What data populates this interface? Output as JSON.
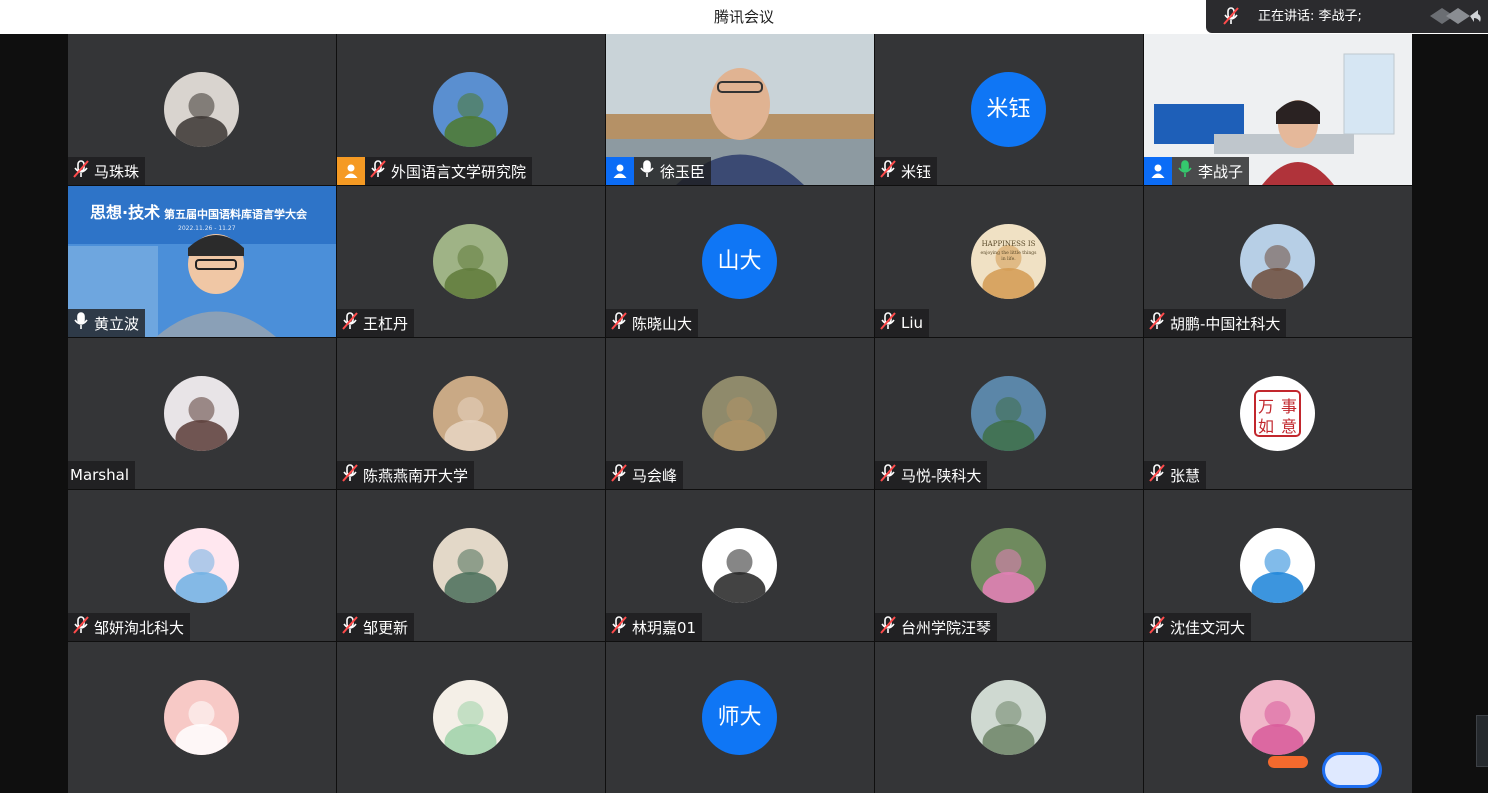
{
  "app": {
    "title": "腾讯会议"
  },
  "speaking": {
    "label": "正在讲话: 李战子;"
  },
  "colors": {
    "accent": "#0f76f5",
    "tile": "#343537",
    "speaking_outline": "#4dc68b",
    "host_badge": "#0b6cf6"
  },
  "participants": [
    {
      "name": "马珠珠",
      "mic": "muted",
      "avatar": "photo"
    },
    {
      "name": "外国语言文学研究院",
      "mic": "muted",
      "avatar": "photo",
      "badge": "orange-user-icon"
    },
    {
      "name": "徐玉臣",
      "mic": "on",
      "avatar": "video",
      "badge": "user-icon"
    },
    {
      "name": "米钰",
      "mic": "muted",
      "avatar": "initials",
      "initials": "米钰"
    },
    {
      "name": "李战子",
      "mic": "speaking",
      "avatar": "video",
      "badge": "user-icon"
    },
    {
      "name": "黄立波",
      "mic": "on",
      "avatar": "video",
      "video_banner": {
        "line1": "思想·技术",
        "line2": "第五届中国语料库语言学大会",
        "dates": "2022.11.26 - 11.27"
      }
    },
    {
      "name": "王杠丹",
      "mic": "muted",
      "avatar": "photo"
    },
    {
      "name": "陈晓山大",
      "mic": "muted",
      "avatar": "initials",
      "initials": "山大"
    },
    {
      "name": "Liu",
      "mic": "muted",
      "avatar": "photo",
      "avatar_text": {
        "line1": "HAPPINESS IS",
        "line2": "enjoying the little things",
        "line3": "in life."
      }
    },
    {
      "name": "胡鹏-中国社科大",
      "mic": "muted",
      "avatar": "photo"
    },
    {
      "name": "Marshal",
      "mic": "none",
      "avatar": "photo"
    },
    {
      "name": "陈燕燕南开大学",
      "mic": "muted",
      "avatar": "photo"
    },
    {
      "name": "马会峰",
      "mic": "muted",
      "avatar": "photo"
    },
    {
      "name": "马悦-陕科大",
      "mic": "muted",
      "avatar": "photo"
    },
    {
      "name": "张慧",
      "mic": "muted",
      "avatar": "photo",
      "seal_chars": [
        "万",
        "事",
        "如",
        "意"
      ]
    },
    {
      "name": "邹妍洵北科大",
      "mic": "muted",
      "avatar": "photo"
    },
    {
      "name": "邹更新",
      "mic": "muted",
      "avatar": "photo"
    },
    {
      "name": "林玥嘉01",
      "mic": "muted",
      "avatar": "photo"
    },
    {
      "name": "台州学院汪琴",
      "mic": "muted",
      "avatar": "photo"
    },
    {
      "name": "沈佳文河大",
      "mic": "muted",
      "avatar": "photo"
    },
    {
      "name": "",
      "mic": "none",
      "avatar": "photo"
    },
    {
      "name": "",
      "mic": "none",
      "avatar": "photo"
    },
    {
      "name": "",
      "mic": "none",
      "avatar": "initials",
      "initials": "师大"
    },
    {
      "name": "",
      "mic": "none",
      "avatar": "photo"
    },
    {
      "name": "",
      "mic": "none",
      "avatar": "photo"
    }
  ]
}
